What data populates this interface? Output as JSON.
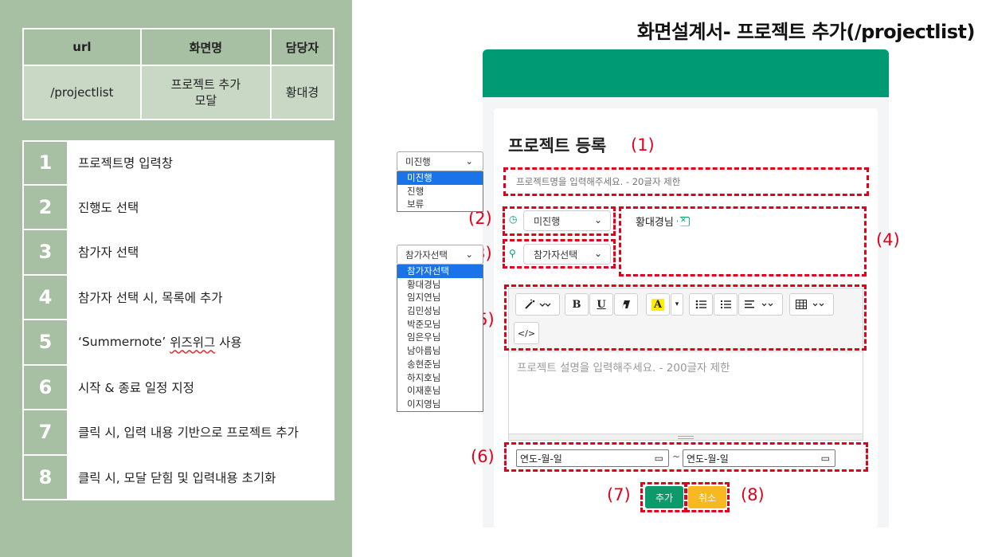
{
  "page_title": "화면설계서- 프로젝트 추가(/projectlist)",
  "spec_table": {
    "headers": [
      "url",
      "화면명",
      "담당자"
    ],
    "row": [
      "/projectlist",
      "프로젝트 추가\n모달",
      "황대경"
    ],
    "row_screen_line1": "프로젝트 추가",
    "row_screen_line2": "모달"
  },
  "steps": [
    {
      "num": "1",
      "text": "프로젝트명 입력창"
    },
    {
      "num": "2",
      "text": "진행도 선택"
    },
    {
      "num": "3",
      "text": "참가자 선택"
    },
    {
      "num": "4",
      "text": "참가자 선택 시, 목록에 추가"
    },
    {
      "num": "5",
      "text_a": "‘Summernote’ ",
      "text_b": "위즈위그",
      "text_c": " 사용"
    },
    {
      "num": "6",
      "text": "시작 & 종료 일정 지정"
    },
    {
      "num": "7",
      "text": "클릭 시, 입력 내용 기반으로 프로젝트 추가"
    },
    {
      "num": "8",
      "text": "클릭 시, 모달 닫힘 및 입력내용 초기화"
    }
  ],
  "modal": {
    "title": "프로젝트 등록",
    "name_placeholder": "프로젝트명을 입력해주세요. - 20글자 제한",
    "status_select": "미진행",
    "participant_select": "참가자선택",
    "participant_chip": "황대경님",
    "description_placeholder": "프로젝트 설명을 입력해주세요. - 200글자 제한",
    "date_placeholder": "연도-월-일",
    "tilde": "~",
    "add_button": "추가",
    "cancel_button": "취소"
  },
  "annotations": [
    "(1)",
    "(2)",
    "(3)",
    "(4)",
    "(5)",
    "(6)",
    "(7)",
    "(8)"
  ],
  "status_dropdown": {
    "selected": "미진행",
    "options": [
      "미진행",
      "진행",
      "보류"
    ]
  },
  "participant_dropdown": {
    "selected": "참가자선택",
    "options": [
      "참가자선택",
      "황대경님",
      "임지연님",
      "김민성님",
      "박준모님",
      "임은우님",
      "남아름님",
      "송현준님",
      "하지호님",
      "이재훈님",
      "이지영님"
    ]
  },
  "toolbar": {
    "bold": "B",
    "underline": "U",
    "font_color": "A",
    "code_view": "</>"
  },
  "colors": {
    "panel_bg": "#a7bfa3",
    "modal_header": "#009a74",
    "annotation_red": "#e3001b",
    "add_button": "#0d9a6a",
    "cancel_button": "#f8b820"
  }
}
